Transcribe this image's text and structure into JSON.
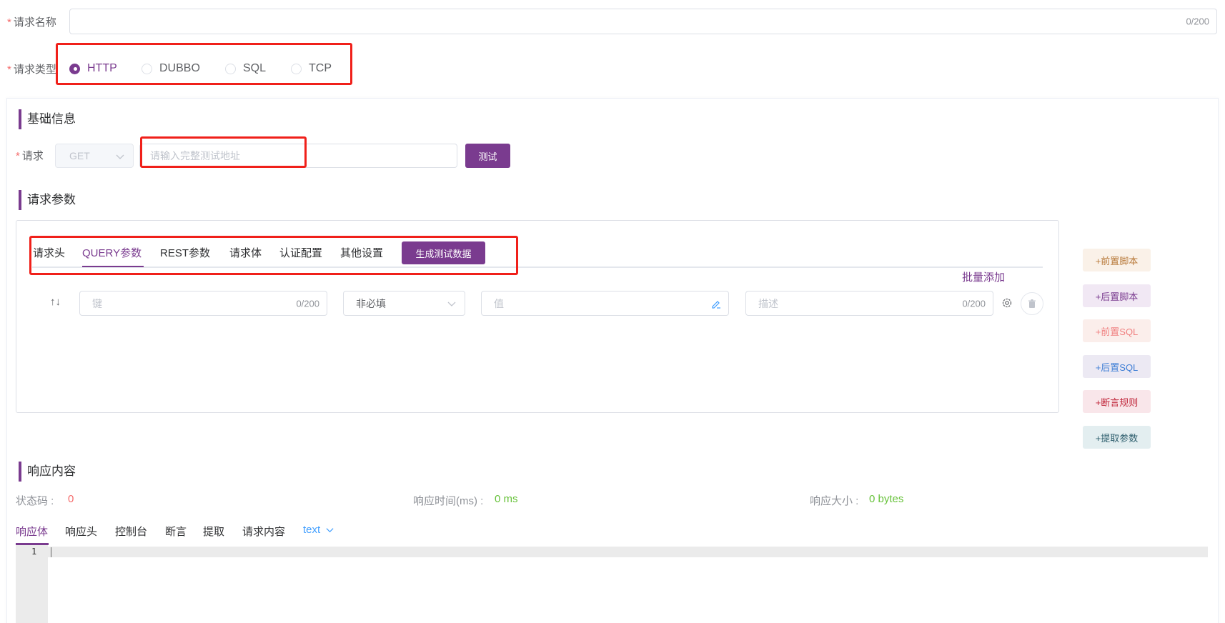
{
  "form": {
    "name_label": "请求名称",
    "name_counter": "0/200",
    "type_label": "请求类型",
    "types": [
      {
        "label": "HTTP",
        "checked": true
      },
      {
        "label": "DUBBO",
        "checked": false
      },
      {
        "label": "SQL",
        "checked": false
      },
      {
        "label": "TCP",
        "checked": false
      }
    ]
  },
  "basic": {
    "title": "基础信息",
    "request_label": "请求",
    "method": "GET",
    "url_placeholder": "请输入完整测试地址",
    "test_button": "测试"
  },
  "params": {
    "title": "请求参数",
    "tabs": [
      "请求头",
      "QUERY参数",
      "REST参数",
      "请求体",
      "认证配置",
      "其他设置"
    ],
    "active_tab": "QUERY参数",
    "generate_button": "生成测试数据",
    "batch_add": "批量添加",
    "row": {
      "key_placeholder": "键",
      "key_counter": "0/200",
      "required_value": "非必填",
      "value_placeholder": "值",
      "desc_placeholder": "描述",
      "desc_counter": "0/200"
    }
  },
  "side_buttons": [
    {
      "label": "+前置脚本",
      "color": "#b97b3c",
      "bg": "#faf1e8"
    },
    {
      "label": "+后置脚本",
      "color": "#7a3b8f",
      "bg": "#f1e8f4"
    },
    {
      "label": "+前置SQL",
      "color": "#f08080",
      "bg": "#fbeeeb"
    },
    {
      "label": "+后置SQL",
      "color": "#3f7fd6",
      "bg": "#ece9f3"
    },
    {
      "label": "+断言规则",
      "color": "#c0263a",
      "bg": "#f9e6ea"
    },
    {
      "label": "+提取参数",
      "color": "#2f5f6e",
      "bg": "#e3eef0"
    }
  ],
  "response": {
    "title": "响应内容",
    "status_label": "状态码 :",
    "status_value": "0",
    "time_label": "响应时间(ms) :",
    "time_value": "0 ms",
    "size_label": "响应大小 :",
    "size_value": "0 bytes",
    "tabs": [
      "响应体",
      "响应头",
      "控制台",
      "断言",
      "提取",
      "请求内容"
    ],
    "active_tab": "响应体",
    "format": "text",
    "line_number": "1"
  }
}
